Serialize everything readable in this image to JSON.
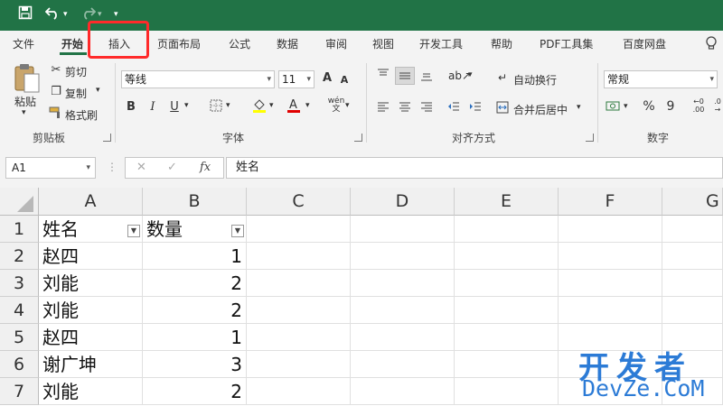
{
  "quick_access": {
    "save_icon": "save-icon",
    "undo_icon": "undo-icon",
    "redo_icon": "redo-icon",
    "more": "▾"
  },
  "tabs": [
    "文件",
    "开始",
    "插入",
    "页面布局",
    "公式",
    "数据",
    "审阅",
    "视图",
    "开发工具",
    "帮助",
    "PDF工具集",
    "百度网盘"
  ],
  "ribbon": {
    "clipboard": {
      "paste": "粘贴",
      "cut": "剪切",
      "copy": "复制",
      "format_painter": "格式刷",
      "label": "剪贴板"
    },
    "font": {
      "name": "等线",
      "size": "11",
      "bold": "B",
      "italic": "I",
      "underline": "U",
      "label": "字体"
    },
    "alignment": {
      "wrap_text": "自动换行",
      "merge_center": "合并后居中",
      "label": "对齐方式"
    },
    "number": {
      "format": "常规",
      "percent": "%",
      "comma": "9",
      "label": "数字"
    }
  },
  "formula_bar": {
    "name_box": "A1",
    "cancel": "✕",
    "enter": "✓",
    "fx": "fx",
    "content": "姓名"
  },
  "grid": {
    "columns": [
      "A",
      "B",
      "C",
      "D",
      "E",
      "F",
      "G"
    ],
    "rows": [
      "1",
      "2",
      "3",
      "4",
      "5",
      "6",
      "7"
    ],
    "header": {
      "a": "姓名",
      "b": "数量"
    },
    "data": [
      {
        "name": "赵四",
        "qty": "1"
      },
      {
        "name": "刘能",
        "qty": "2"
      },
      {
        "name": "刘能",
        "qty": "2"
      },
      {
        "name": "赵四",
        "qty": "1"
      },
      {
        "name": "谢广坤",
        "qty": "3"
      },
      {
        "name": "刘能",
        "qty": "2"
      }
    ]
  },
  "watermark": {
    "line1": "开发者",
    "line2": "DevZe.CoM"
  },
  "colors": {
    "excel_green": "#217346",
    "highlight_red": "#ff2a2a",
    "watermark_blue": "#2c7bd6"
  }
}
